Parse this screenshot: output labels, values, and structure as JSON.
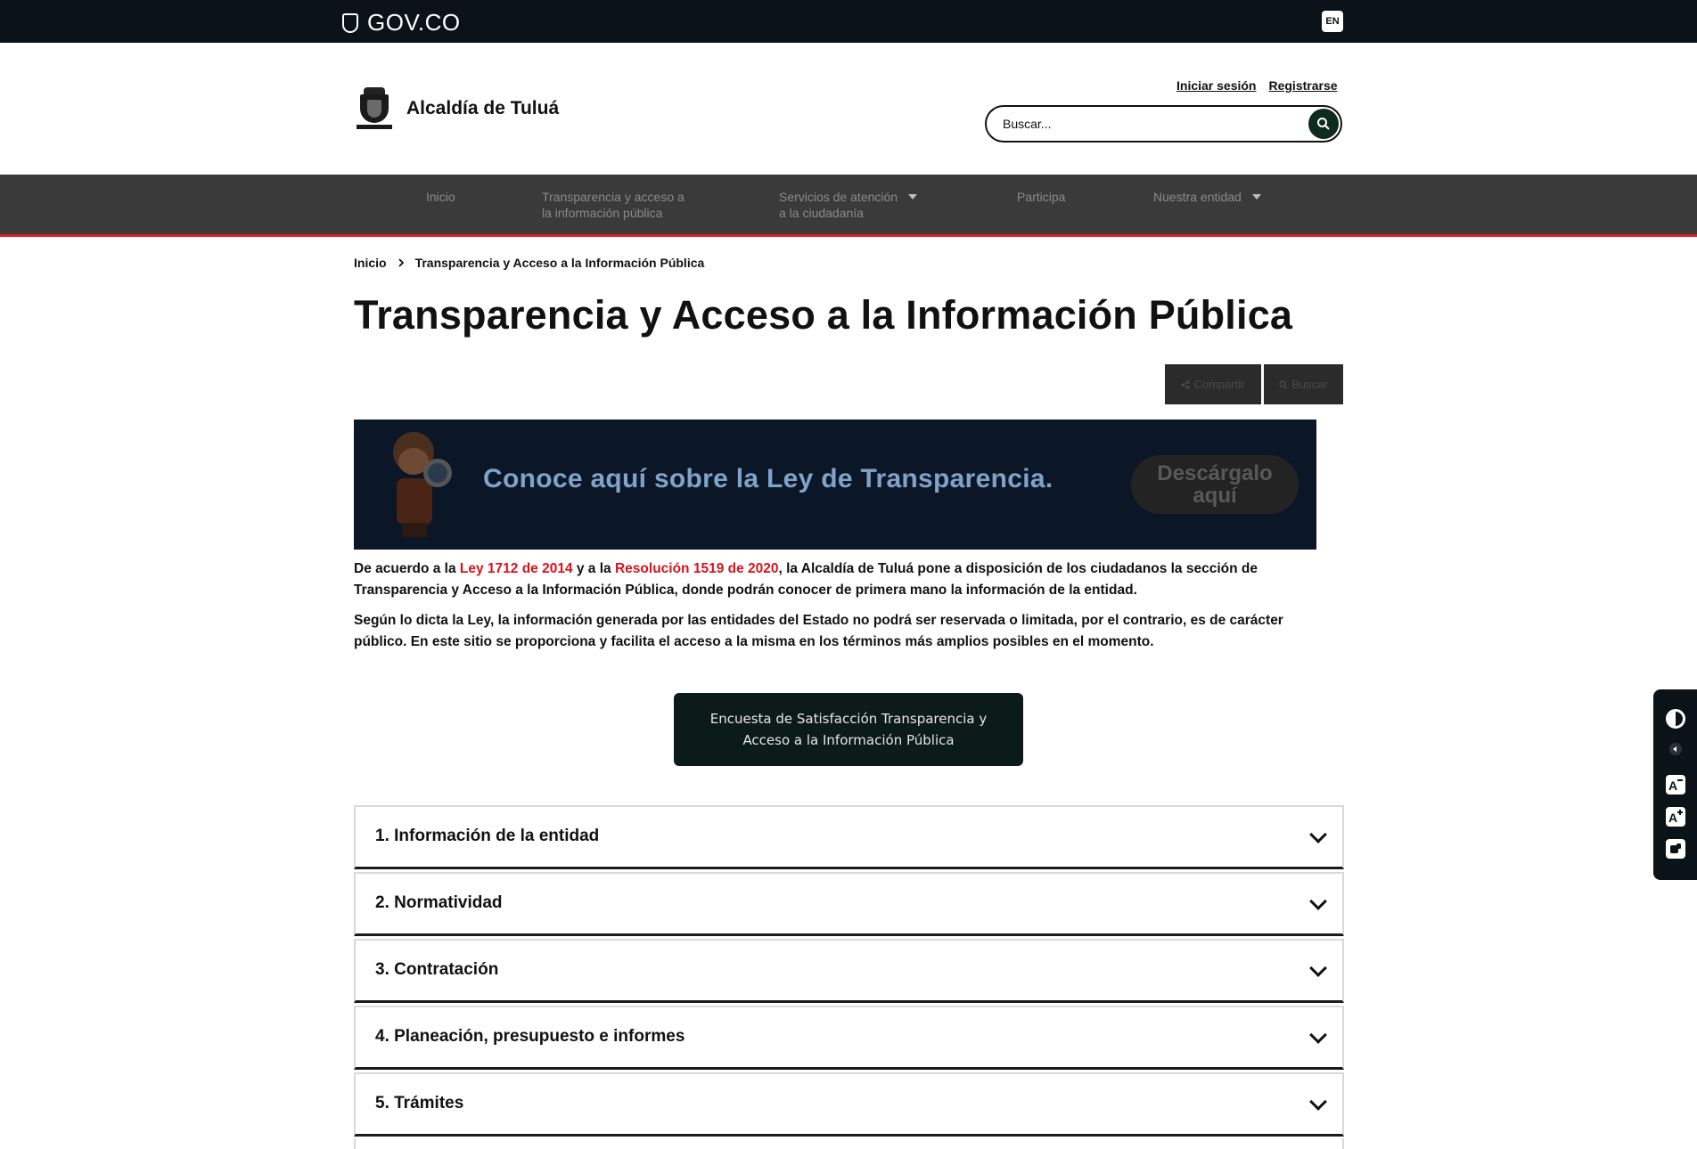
{
  "gov_bar": {
    "brand": "GOV.CO",
    "language_label": "EN"
  },
  "header": {
    "site_name": "Alcaldía de Tuluá",
    "login_label": "Iniciar sesión",
    "register_label": "Registrarse",
    "search_placeholder": "Buscar..."
  },
  "nav": {
    "items": [
      {
        "label": "Inicio"
      },
      {
        "label_line1": "Transparencia y acceso a",
        "label_line2": "la información pública"
      },
      {
        "label_line1": "Servicios de atención",
        "label_line2": "a la ciudadanía"
      },
      {
        "label": "Participa"
      },
      {
        "label": "Nuestra entidad"
      }
    ]
  },
  "breadcrumb": {
    "home": "Inicio",
    "current": "Transparencia y Acceso a la Información Pública"
  },
  "page_title": "Transparencia y Acceso a la Información Pública",
  "tools": {
    "share_label": "Compartir",
    "search_label": "Buscar"
  },
  "banner": {
    "text": "Conoce aquí sobre la Ley de Transparencia.",
    "download_line1": "Descárgalo",
    "download_line2": "aquí"
  },
  "intro": {
    "p1_a": "De acuerdo a la ",
    "p1_law": "Ley 1712 de 2014",
    "p1_b": " y a la ",
    "p1_res": "Resolución 1519 de 2020",
    "p1_c": ", la ",
    "p1_entity": "Alcaldía de Tuluá",
    "p1_d": " pone a disposición de los ciudadanos la sección de Transparencia y Acceso a la Información Pública, donde podrán conocer de primera mano la información de la entidad.",
    "p2": "Según lo dicta la Ley, la información generada por las entidades del Estado no podrá ser reservada o limitada, por el contrario, es de carácter público. En este sitio se proporciona y facilita el acceso a la misma en los términos más amplios posibles en el momento."
  },
  "survey_button": "Encuesta de Satisfacción Transparencia y Acceso a la Información Pública",
  "accordion": [
    {
      "label": "1. Información de la entidad"
    },
    {
      "label": "2. Normatividad"
    },
    {
      "label": "3. Contratación"
    },
    {
      "label": "4. Planeación, presupuesto e informes"
    },
    {
      "label": "5. Trámites"
    }
  ],
  "accessibility": {
    "icons": [
      "contrast-icon",
      "collapse-icon",
      "decrease-font-icon",
      "increase-font-icon",
      "sign-language-icon"
    ]
  },
  "colors": {
    "gov_bar": "#0b1218",
    "nav_bg": "#3a3a3a",
    "nav_accent": "#e0202b",
    "link_red": "#d8131b",
    "survey_bg": "#0b1b17"
  }
}
